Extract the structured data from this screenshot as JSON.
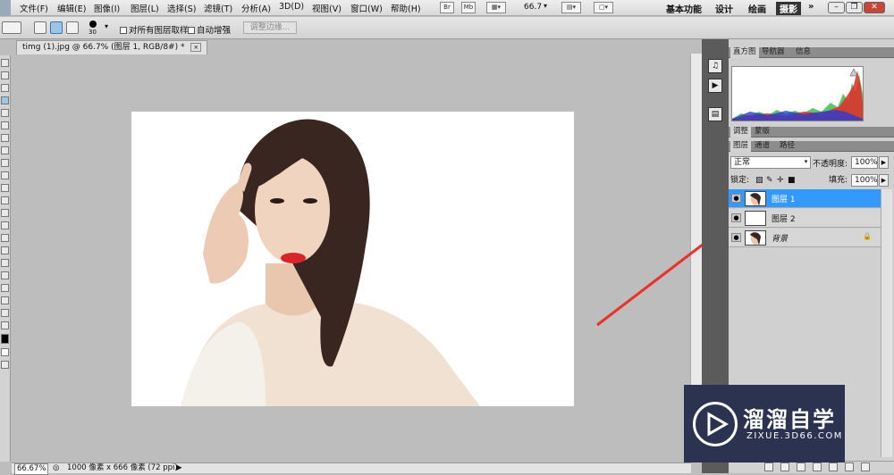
{
  "menubar": {
    "items": [
      "文件(F)",
      "编辑(E)",
      "图像(I)",
      "图层(L)",
      "选择(S)",
      "滤镜(T)",
      "分析(A)",
      "3D(D)",
      "视图(V)",
      "窗口(W)",
      "帮助(H)"
    ],
    "br_label": "Br",
    "mb_label": "Mb",
    "zoom": "66.7",
    "workspaces": [
      "基本功能",
      "设计",
      "绘画",
      "摄影"
    ],
    "more": "»"
  },
  "options": {
    "brush_size": "30",
    "sample_all_layers": "对所有图层取样",
    "auto_enhance": "自动增强",
    "refine_edge": "调整边缘..."
  },
  "document": {
    "tab_title": "timg (1).jpg @ 66.7% (图层 1, RGB/8#) *",
    "close": "×"
  },
  "status": {
    "zoom": "66.67%",
    "doc_info": "1000 像素 x 666 像素 (72 ppi)"
  },
  "panels": {
    "histogram_tabs": [
      "直方图",
      "导航器",
      "信息"
    ],
    "adjust_tabs": [
      "调整",
      "蒙版"
    ],
    "layers_tabs": [
      "图层",
      "通道",
      "路径"
    ],
    "blend_mode": "正常",
    "opacity_label": "不透明度:",
    "opacity_value": "100%",
    "lock_label": "锁定:",
    "fill_label": "填充:",
    "fill_value": "100%"
  },
  "layers": [
    {
      "name": "图层 1",
      "active": true
    },
    {
      "name": "图层 2",
      "active": false
    },
    {
      "name": "背景",
      "active": false,
      "locked": true
    }
  ],
  "watermark": {
    "name": "溜溜自学",
    "url": "ZIXUE.3D66.COM"
  },
  "colors": {
    "layer_selected": "#3399ff",
    "arrow": "#e8322b",
    "watermark_bg": "#2b3350"
  }
}
